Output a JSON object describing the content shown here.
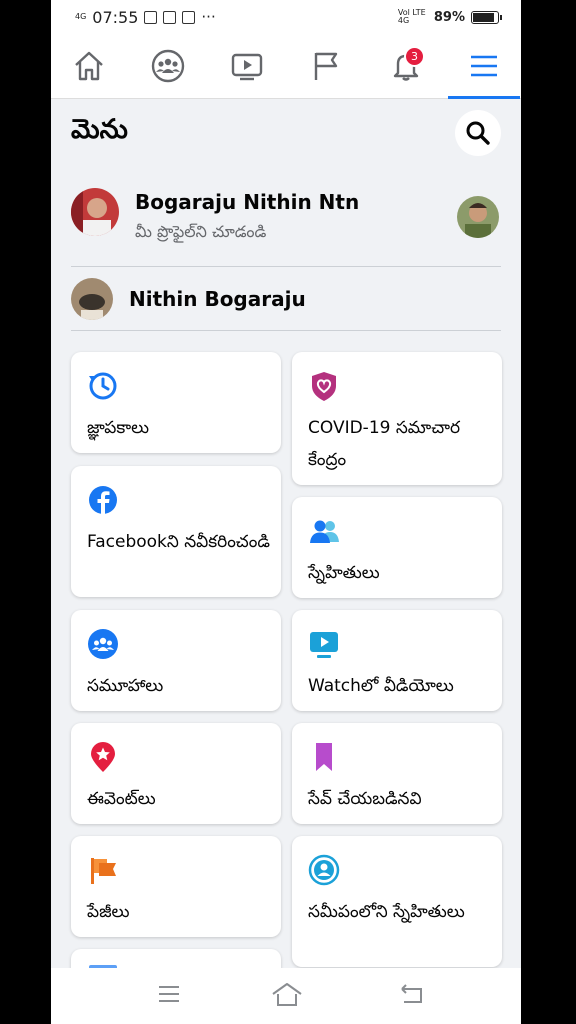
{
  "status_bar": {
    "network_left": "4G",
    "time": "07:55",
    "more": "···",
    "network_right": "Vol LTE 4G",
    "battery": "89%"
  },
  "nav": {
    "tabs": [
      "home",
      "groups",
      "watch",
      "pages",
      "notifications",
      "menu"
    ],
    "notification_count": "3",
    "active_tab": "menu"
  },
  "header": {
    "title": "మెను"
  },
  "profile": {
    "name": "Bogaraju Nithin Ntn",
    "subtitle": "మీ ప్రొఫైల్‌ని చూడండి"
  },
  "page": {
    "name": "Nithin Bogaraju"
  },
  "shortcuts_left": [
    {
      "label": "జ్ఞాపకాలు",
      "icon": "memories-icon"
    },
    {
      "label": "Facebookని నవీకరించండి",
      "icon": "facebook-icon"
    },
    {
      "label": "సమూహాలు",
      "icon": "groups-icon"
    },
    {
      "label": "ఈవెంట్‌లు",
      "icon": "events-icon"
    },
    {
      "label": "పేజీలు",
      "icon": "pages-icon"
    }
  ],
  "shortcuts_right": [
    {
      "label": "COVID-19 సమాచార కేంద్రం",
      "icon": "covid-icon"
    },
    {
      "label": "స్నేహితులు",
      "icon": "friends-icon"
    },
    {
      "label": "Watchలో వీడియోలు",
      "icon": "watch-icon"
    },
    {
      "label": "సేవ్ చేయబడినవి",
      "icon": "saved-icon"
    },
    {
      "label": "సమీపంలోని స్నేహితులు",
      "icon": "nearby-friends-icon"
    }
  ],
  "colors": {
    "brand_blue": "#1877f2",
    "badge_red": "#e41e3f",
    "background": "#f0f2f5"
  }
}
